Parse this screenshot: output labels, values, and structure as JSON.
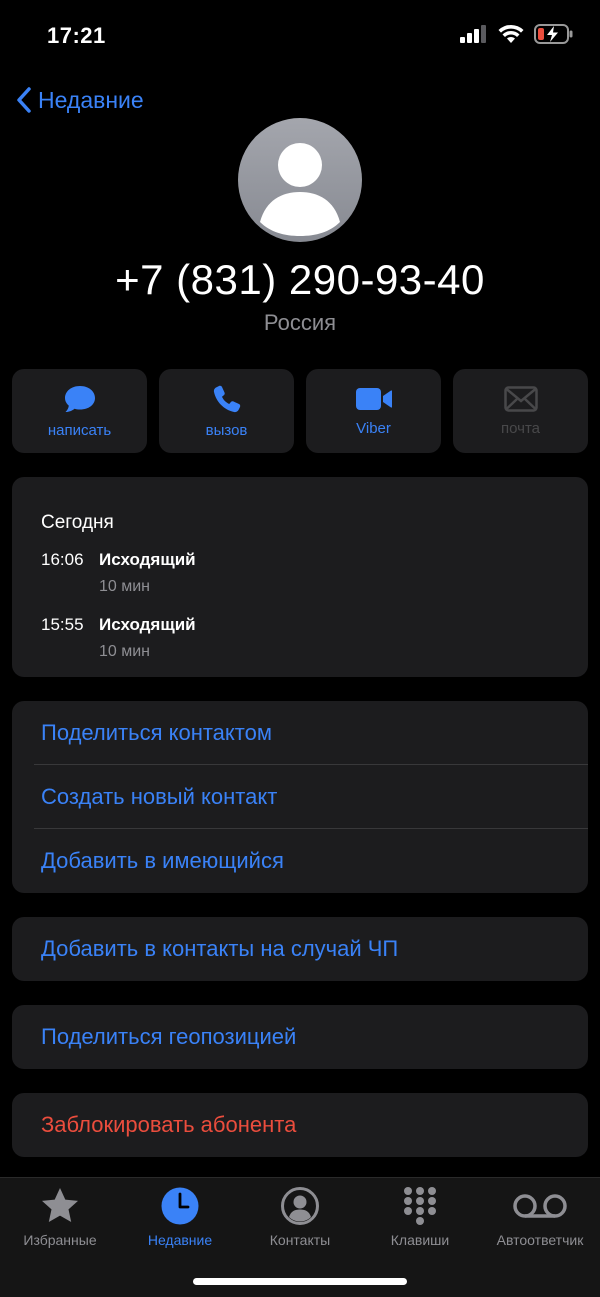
{
  "status": {
    "time": "17:21"
  },
  "nav": {
    "back_label": "Недавние"
  },
  "contact": {
    "phone": "+7 (831) 290-93-40",
    "country": "Россия"
  },
  "actions": [
    {
      "label": "написать",
      "icon": "message-icon"
    },
    {
      "label": "вызов",
      "icon": "phone-icon"
    },
    {
      "label": "Viber",
      "icon": "video-icon"
    },
    {
      "label": "почта",
      "icon": "mail-icon"
    }
  ],
  "history": {
    "title": "Сегодня",
    "calls": [
      {
        "time": "16:06",
        "type": "Исходящий",
        "duration": "10 мин"
      },
      {
        "time": "15:55",
        "type": "Исходящий",
        "duration": "10 мин"
      }
    ]
  },
  "menu": {
    "share_contact": "Поделиться контактом",
    "create_contact": "Создать новый контакт",
    "add_existing": "Добавить в имеющийся",
    "add_emergency": "Добавить в контакты на случай ЧП",
    "share_location": "Поделиться геопозицией",
    "block": "Заблокировать абонента"
  },
  "tabs": [
    {
      "label": "Избранные",
      "icon": "star-icon"
    },
    {
      "label": "Недавние",
      "icon": "clock-icon",
      "active": true
    },
    {
      "label": "Контакты",
      "icon": "person-circle-icon"
    },
    {
      "label": "Клавиши",
      "icon": "keypad-icon"
    },
    {
      "label": "Автоответчик",
      "icon": "voicemail-icon"
    }
  ],
  "colors": {
    "accent": "#3a82f7",
    "destructive": "#eb4d3d",
    "card": "#1c1c1e",
    "secondary_text": "#8e8e93"
  }
}
